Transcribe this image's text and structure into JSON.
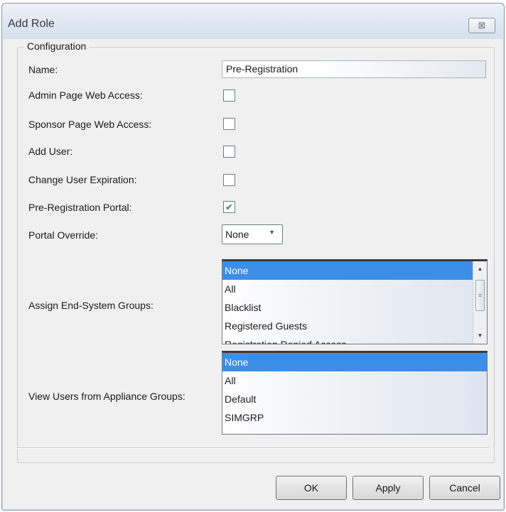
{
  "window": {
    "title": "Add Role",
    "close_glyph": "⊠"
  },
  "configuration": {
    "legend": "Configuration",
    "name_label": "Name:",
    "name_value": "Pre-Registration",
    "admin_page_label": "Admin Page Web Access:",
    "sponsor_page_label": "Sponsor Page Web Access:",
    "add_user_label": "Add User:",
    "change_expiration_label": "Change User Expiration:",
    "pre_reg_portal_label": "Pre-Registration Portal:",
    "pre_reg_portal_checked": true,
    "admin_page_checked": false,
    "sponsor_page_checked": false,
    "add_user_checked": false,
    "change_expiration_checked": false,
    "portal_override_label": "Portal Override:",
    "portal_override_value": "None",
    "assign_groups_label": "Assign End-System Groups:",
    "assign_groups_items": [
      "None",
      "All",
      "Blacklist",
      "Registered Guests",
      "Registration Denied Access"
    ],
    "assign_groups_selected": "None",
    "view_users_label": "View Users from Appliance Groups:",
    "view_users_items": [
      "None",
      "All",
      "Default",
      "SIMGRP"
    ],
    "view_users_selected": "None"
  },
  "buttons": {
    "ok": "OK",
    "apply": "Apply",
    "cancel": "Cancel"
  },
  "colors": {
    "selection": "#3d8ee6",
    "checkmark": "#2e8b2e"
  },
  "icons": {
    "close": "close-icon",
    "checkmark": "checkmark-icon",
    "dropdown": "chevron-down-icon",
    "scroll_up": "scroll-up-icon",
    "scroll_down": "scroll-down-icon"
  }
}
